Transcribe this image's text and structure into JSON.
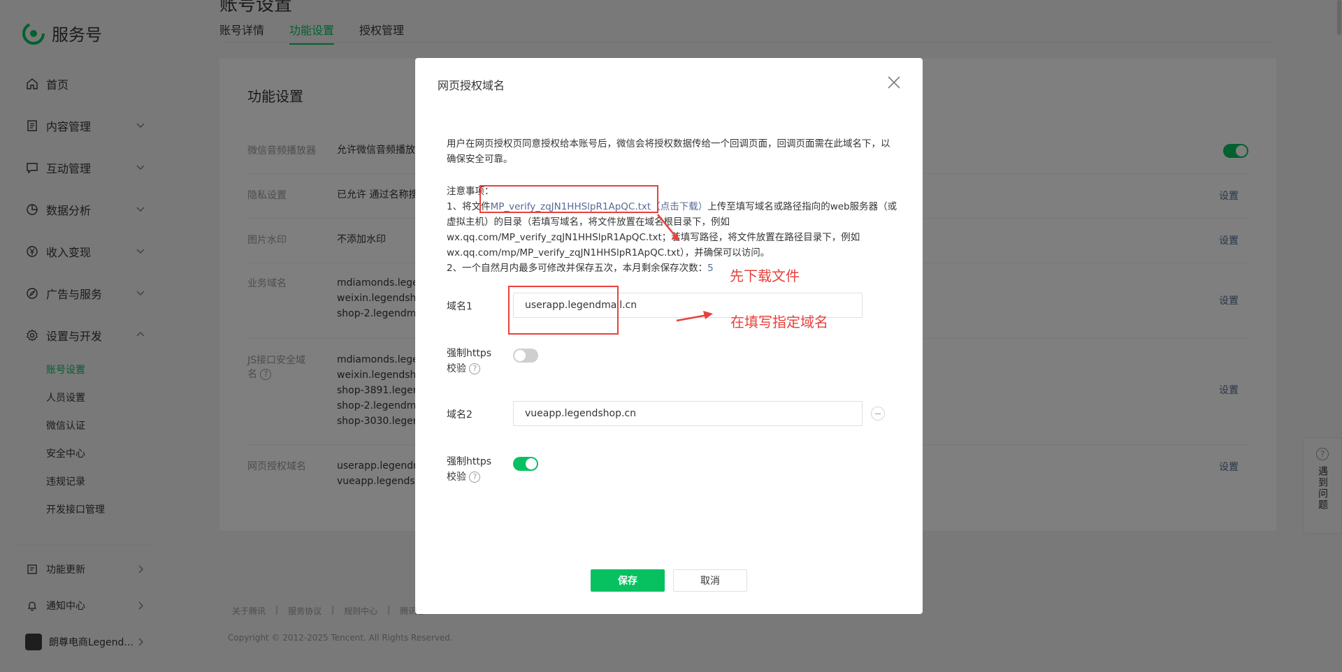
{
  "brand": {
    "name": "服务号"
  },
  "sidebar": {
    "items": [
      {
        "label": "首页",
        "icon": "home-icon"
      },
      {
        "label": "内容管理",
        "icon": "document-icon"
      },
      {
        "label": "互动管理",
        "icon": "chat-icon"
      },
      {
        "label": "数据分析",
        "icon": "pie-chart-icon"
      },
      {
        "label": "收入变现",
        "icon": "yen-icon"
      },
      {
        "label": "广告与服务",
        "icon": "compass-icon"
      },
      {
        "label": "设置与开发",
        "icon": "gear-icon"
      }
    ],
    "sub_items": [
      "账号设置",
      "人员设置",
      "微信认证",
      "安全中心",
      "违规记录",
      "开发接口管理"
    ],
    "bottom": [
      {
        "label": "功能更新",
        "icon": "update-icon"
      },
      {
        "label": "通知中心",
        "icon": "bell-icon"
      },
      {
        "label": "朗尊电商Legend...",
        "icon": "avatar"
      }
    ]
  },
  "main": {
    "page_title": "账号设置",
    "tabs": [
      "账号详情",
      "功能设置",
      "授权管理"
    ],
    "card_title": "功能设置",
    "rows": [
      {
        "label": "微信音频播放器",
        "value": "允许微信音频播放器",
        "action": ""
      },
      {
        "label": "隐私设置",
        "value": "已允许 通过名称搜",
        "action": "设置"
      },
      {
        "label": "图片水印",
        "value": "不添加水印",
        "action": "设置"
      },
      {
        "label": "业务域名",
        "values": [
          "mdiamonds.leger",
          "weixin.legendsho",
          "shop-2.legendma"
        ],
        "action": "设置"
      },
      {
        "label": "JS接口安全域名",
        "values": [
          "mdiamonds.leger",
          "weixin.legendsho",
          "shop-3891.legen",
          "shop-2.legendma",
          "shop-3030.legen"
        ],
        "action": "设置"
      },
      {
        "label": "网页授权域名",
        "values": [
          "userapp.legendm",
          "vueapp.legendsh"
        ],
        "action": "设置"
      }
    ],
    "footer_links": [
      "关于腾讯",
      "|",
      "服务协议",
      "|",
      "规则中心",
      "|",
      "腾讯客"
    ],
    "copyright": "Copyright © 2012-2025 Tencent. All Rights Reserved.",
    "helper": {
      "label": "遇到问题"
    }
  },
  "modal": {
    "title": "网页授权域名",
    "desc": "用户在网页授权页同意授权给本账号后，微信会将授权数据传给一个回调页面，回调页面需在此域名下，以确保安全可靠。",
    "notice_title": "注意事项：",
    "notice_1_prefix": "1、将文件",
    "notice_1_file": "MP_verify_zqJN1HHSlpR1ApQC.txt（点击下载）",
    "notice_1_rest": "上传至填写域名或路径指向的web服务器（或虚拟主机）的目录（若填写域名，将文件放置在域名根目录下，例如wx.qq.com/MP_verify_zqJN1HHSlpR1ApQC.txt；若填写路径，将文件放置在路径目录下，例如wx.qq.com/mp/MP_verify_zqJN1HHSlpR1ApQC.txt），并确保可以访问。",
    "notice_2": "2、一个自然月内最多可修改并保存五次，本月剩余保存次数：",
    "notice_2_count": "5",
    "domain1_label": "域名1",
    "domain1_value": "userapp.legendmall.cn",
    "https1_label": "强制https",
    "https1_sub": "校验",
    "https1_on": false,
    "domain2_label": "域名2",
    "domain2_value": "vueapp.legendshop.cn",
    "https2_label": "强制https",
    "https2_sub": "校验",
    "https2_on": true,
    "save_label": "保存",
    "cancel_label": "取消"
  },
  "annotations": {
    "download_hint": "先下载文件",
    "fill_hint": "在填写指定域名"
  },
  "colors": {
    "accent": "#07c160",
    "link": "#576b95",
    "annotation": "#e8413c"
  }
}
